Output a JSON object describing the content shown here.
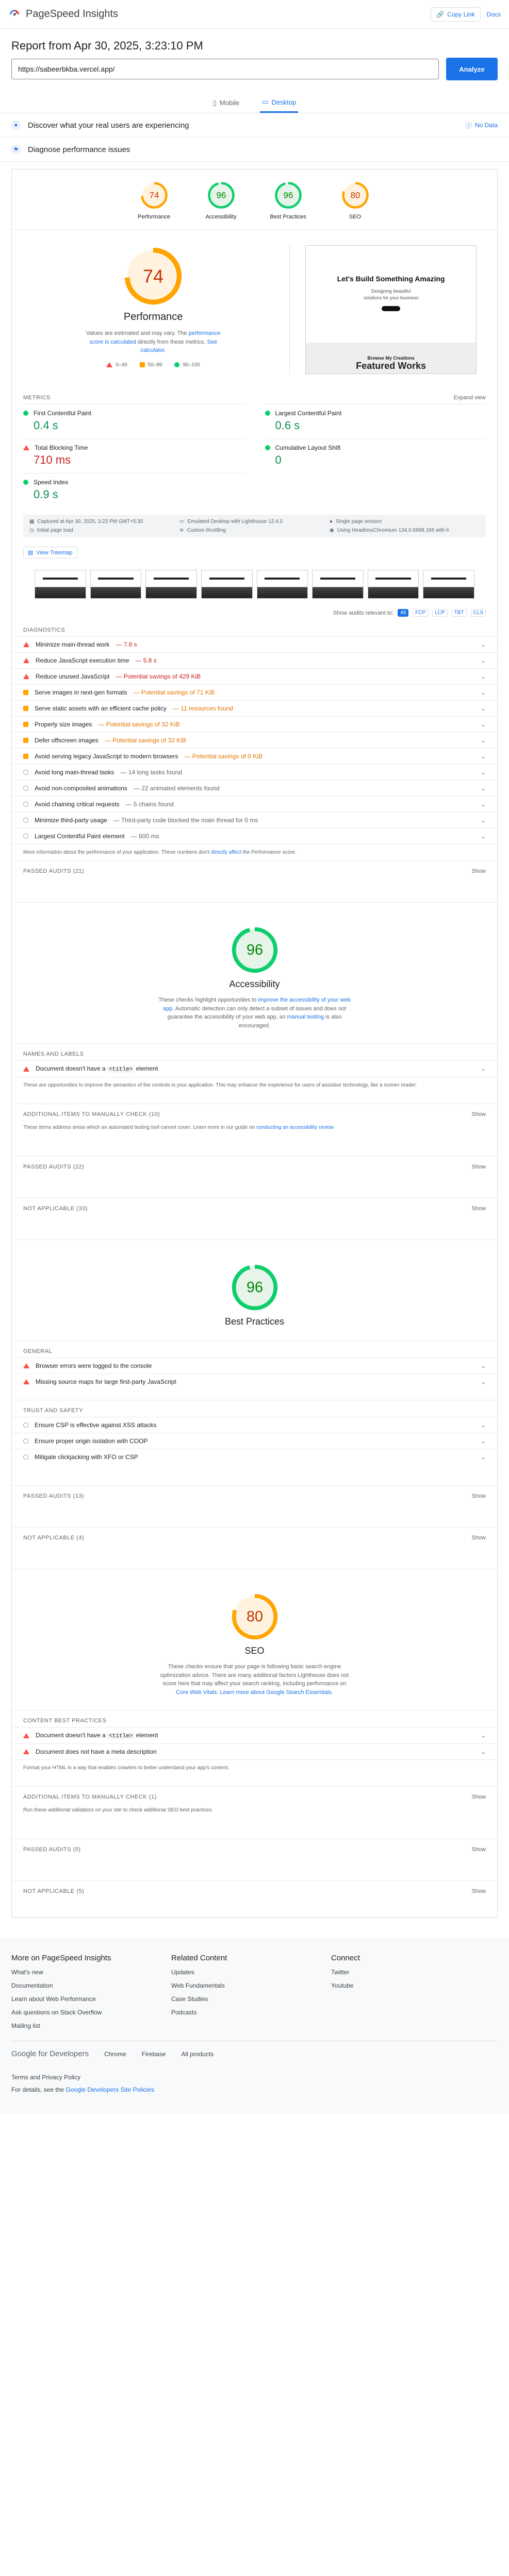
{
  "app": {
    "title": "PageSpeed Insights",
    "copy_link": "Copy Link",
    "docs": "Docs"
  },
  "report": {
    "title": "Report from Apr 30, 2025, 3:23:10 PM",
    "url": "https://sabeerbkba.vercel.app/",
    "analyze": "Analyze"
  },
  "tabs": {
    "mobile": "Mobile",
    "desktop": "Desktop"
  },
  "crux": {
    "label": "Discover what your real users are experiencing",
    "no_data": "No Data"
  },
  "diagnose": {
    "label": "Diagnose performance issues"
  },
  "scores": [
    {
      "name": "Performance",
      "score": "74",
      "value": 74,
      "color": "#ffa400",
      "text_color": "#c33300",
      "bg": "#fff3e0"
    },
    {
      "name": "Accessibility",
      "score": "96",
      "value": 96,
      "color": "#0cce6b",
      "text_color": "#008800",
      "bg": "#e6f4ea"
    },
    {
      "name": "Best Practices",
      "score": "96",
      "value": 96,
      "color": "#0cce6b",
      "text_color": "#008800",
      "bg": "#e6f4ea"
    },
    {
      "name": "SEO",
      "score": "80",
      "value": 80,
      "color": "#ffa400",
      "text_color": "#c33300",
      "bg": "#fff3e0"
    }
  ],
  "performance": {
    "title": "Performance",
    "note_pre": "Values are estimated and may vary. The",
    "note_link": "performance score is calculated",
    "note_mid": "directly from these metrics.",
    "note_link2": "See calculator.",
    "legend": [
      "0–49",
      "50–89",
      "90–100"
    ],
    "shot": {
      "h1": "Let's Build Something Amazing",
      "sub1": "Designing beautiful",
      "sub2": "solutions for your business",
      "small": "Browse My Creations",
      "big": "Featured Works"
    }
  },
  "metrics": {
    "label": "METRICS",
    "expand": "Expand view",
    "items": [
      {
        "name": "First Contentful Paint",
        "value": "0.4 s",
        "status": "good"
      },
      {
        "name": "Largest Contentful Paint",
        "value": "0.6 s",
        "status": "good"
      },
      {
        "name": "Total Blocking Time",
        "value": "710 ms",
        "status": "poor"
      },
      {
        "name": "Cumulative Layout Shift",
        "value": "0",
        "status": "good"
      },
      {
        "name": "Speed Index",
        "value": "0.9 s",
        "status": "good"
      }
    ]
  },
  "info": [
    "Captured at Apr 30, 2025, 3:23 PM GMT+5:30",
    "Emulated Desktop with Lighthouse 12.4.0",
    "Single page session",
    "Initial page load",
    "Custom throttling",
    "Using HeadlessChromium 134.0.6998.165 with lr"
  ],
  "treemap": "View Treemap",
  "filter": {
    "label": "Show audits relevant to:",
    "chips": [
      "All",
      "FCP",
      "LCP",
      "TBT",
      "CLS"
    ]
  },
  "diagnostics": {
    "label": "DIAGNOSTICS",
    "items": [
      {
        "kind": "red",
        "text": "Minimize main-thread work",
        "savings": "— 7.6 s",
        "tone": "red"
      },
      {
        "kind": "red",
        "text": "Reduce JavaScript execution time",
        "savings": "— 5.8 s",
        "tone": "red"
      },
      {
        "kind": "red",
        "text": "Reduce unused JavaScript",
        "savings": "— Potential savings of 429 KiB",
        "tone": "red"
      },
      {
        "kind": "orange",
        "text": "Serve images in next-gen formats",
        "savings": "— Potential savings of 71 KiB",
        "tone": "orange"
      },
      {
        "kind": "orange",
        "text": "Serve static assets with an efficient cache policy",
        "savings": "— 11 resources found",
        "tone": "orange"
      },
      {
        "kind": "orange",
        "text": "Properly size images",
        "savings": "— Potential savings of 32 KiB",
        "tone": "orange"
      },
      {
        "kind": "orange",
        "text": "Defer offscreen images",
        "savings": "— Potential savings of 32 KiB",
        "tone": "orange"
      },
      {
        "kind": "orange",
        "text": "Avoid serving legacy JavaScript to modern browsers",
        "savings": "— Potential savings of 0 KiB",
        "tone": "orange"
      },
      {
        "kind": "gray",
        "text": "Avoid long main-thread tasks",
        "savings": "— 14 long tasks found",
        "tone": "gray"
      },
      {
        "kind": "gray",
        "text": "Avoid non-composited animations",
        "savings": "— 22 animated elements found",
        "tone": "gray"
      },
      {
        "kind": "gray",
        "text": "Avoid chaining critical requests",
        "savings": "— 5 chains found",
        "tone": "gray"
      },
      {
        "kind": "gray",
        "text": "Minimize third-party usage",
        "savings": "— Third-party code blocked the main thread for 0 ms",
        "tone": "gray"
      },
      {
        "kind": "gray",
        "text": "Largest Contentful Paint element",
        "savings": "— 600 ms",
        "tone": "gray"
      }
    ],
    "more_info_pre": "More information about the performance of your application. These numbers don't",
    "more_info_link": "directly affect",
    "more_info_post": "the Performance score."
  },
  "passed_perf": "PASSED AUDITS (21)",
  "show": "Show",
  "accessibility": {
    "title": "Accessibility",
    "desc_pre": "These checks highlight opportunities to",
    "desc_link": "improve the accessibility of your web app",
    "desc_mid": ". Automatic detection can only detect a subset of issues and does not guarantee the accessibility of your web app, so",
    "desc_link2": "manual testing",
    "desc_post": "is also encouraged.",
    "group": "NAMES AND LABELS",
    "item_pre": "Document doesn't have a",
    "item_code": "<title>",
    "item_post": "element",
    "group_note": "These are opportunities to improve the semantics of the controls in your application. This may enhance the experience for users of assistive technology, like a screen reader.",
    "manual": "ADDITIONAL ITEMS TO MANUALLY CHECK (10)",
    "manual_note_pre": "These items address areas which an automated testing tool cannot cover. Learn more in our guide on",
    "manual_link": "conducting an accessibility review",
    "passed": "PASSED AUDITS (22)",
    "na": "NOT APPLICABLE (33)"
  },
  "best_practices": {
    "title": "Best Practices",
    "general": "GENERAL",
    "general_items": [
      "Browser errors were logged to the console",
      "Missing source maps for large first-party JavaScript"
    ],
    "trust": "TRUST AND SAFETY",
    "trust_items": [
      "Ensure CSP is effective against XSS attacks",
      "Ensure proper origin isolation with COOP",
      "Mitigate clickjacking with XFO or CSP"
    ],
    "passed": "PASSED AUDITS (13)",
    "na": "NOT APPLICABLE (4)"
  },
  "seo": {
    "title": "SEO",
    "desc": "These checks ensure that your page is following basic search engine optimization advice. There are many additional factors Lighthouse does not score here that may affect your search ranking, including performance on",
    "desc_link": "Core Web Vitals. Learn more about Google Search Essentials.",
    "group": "CONTENT BEST PRACTICES",
    "item1_pre": "Document doesn't have a",
    "item1_code": "<title>",
    "item1_post": "element",
    "item2": "Document does not have a meta description",
    "group_note": "Format your HTML in a way that enables crawlers to better understand your app's content.",
    "manual": "ADDITIONAL ITEMS TO MANUALLY CHECK (1)",
    "manual_note": "Run these additional validators on your site to check additional SEO best practices.",
    "passed": "PASSED AUDITS (5)",
    "na": "NOT APPLICABLE (5)"
  },
  "footer": {
    "col1": {
      "title": "More on PageSpeed Insights",
      "links": [
        "What's new",
        "Documentation",
        "Learn about Web Performance",
        "Ask questions on Stack Overflow",
        "Mailing list"
      ]
    },
    "col2": {
      "title": "Related Content",
      "links": [
        "Updates",
        "Web Fundamentals",
        "Case Studies",
        "Podcasts"
      ]
    },
    "col3": {
      "title": "Connect",
      "links": [
        "Twitter",
        "Youtube"
      ]
    },
    "brand_google": "Google",
    "brand_dev": "for Developers",
    "bottom_links": [
      "Chrome",
      "Firebase",
      "All products"
    ],
    "terms": "Terms and Privacy Policy",
    "details_pre": "For details, see the",
    "details_link": "Google Developers Site Policies"
  }
}
